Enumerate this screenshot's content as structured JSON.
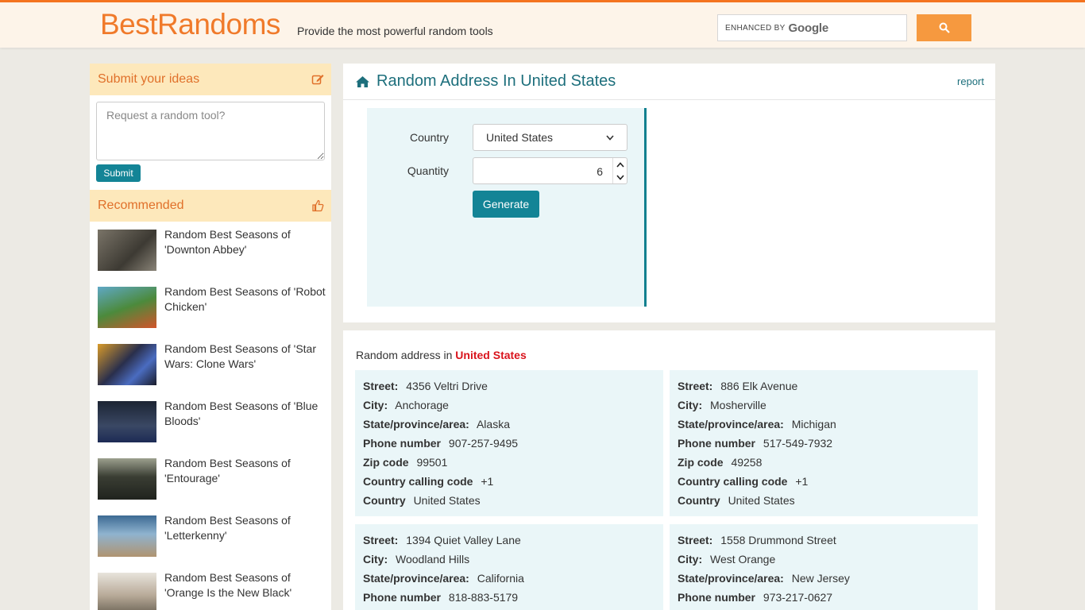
{
  "header": {
    "logo": "BestRandoms",
    "tagline": "Provide the most powerful random tools",
    "search": {
      "enhanced_label": "ENHANCED BY",
      "provider": "Google",
      "placeholder": ""
    }
  },
  "sidebar": {
    "ideas": {
      "title": "Submit your ideas",
      "placeholder": "Request a random tool?",
      "submit_label": "Submit"
    },
    "recommended": {
      "title": "Recommended",
      "items": [
        {
          "label": "Random Best Seasons of 'Downton Abbey'",
          "thumb_color": "#5c5a52"
        },
        {
          "label": "Random Best Seasons of 'Robot Chicken'",
          "thumb_color": "#3f7a3a"
        },
        {
          "label": "Random Best Seasons of 'Star Wars: Clone Wars'",
          "thumb_color": "#2a2f4c"
        },
        {
          "label": "Random Best Seasons of 'Blue Bloods'",
          "thumb_color": "#28344a"
        },
        {
          "label": "Random Best Seasons of 'Entourage'",
          "thumb_color": "#3a3d33"
        },
        {
          "label": "Random Best Seasons of 'Letterkenny'",
          "thumb_color": "#5a7fa0"
        },
        {
          "label": "Random Best Seasons of 'Orange Is the New Black'",
          "thumb_color": "#c9c4ba"
        }
      ]
    }
  },
  "tool": {
    "title": "Random Address In United States",
    "report_label": "report",
    "country_label": "Country",
    "country_value": "United States",
    "quantity_label": "Quantity",
    "quantity_value": "6",
    "generate_label": "Generate"
  },
  "results": {
    "caption_prefix": "Random address in",
    "caption_country": "United States",
    "keys": {
      "street": "Street:",
      "city": "City:",
      "state": "State/province/area:",
      "phone": "Phone number",
      "zip": "Zip code",
      "calling": "Country calling code",
      "country": "Country"
    },
    "addresses": [
      {
        "street": "4356 Veltri Drive",
        "city": "Anchorage",
        "state": "Alaska",
        "phone": "907-257-9495",
        "zip": "99501",
        "calling": "+1",
        "country": "United States"
      },
      {
        "street": "886 Elk Avenue",
        "city": "Mosherville",
        "state": "Michigan",
        "phone": "517-549-7932",
        "zip": "49258",
        "calling": "+1",
        "country": "United States"
      },
      {
        "street": "1394 Quiet Valley Lane",
        "city": "Woodland Hills",
        "state": "California",
        "phone": "818-883-5179"
      },
      {
        "street": "1558 Drummond Street",
        "city": "West Orange",
        "state": "New Jersey",
        "phone": "973-217-0627"
      }
    ]
  },
  "colors": {
    "brand_orange": "#f07a2a",
    "teal": "#138496",
    "highlight_red": "#d9131c",
    "panel_bg": "#eaf6f8"
  }
}
